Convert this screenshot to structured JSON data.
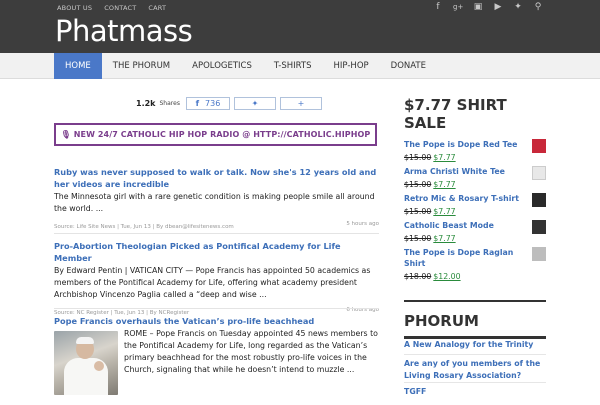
{
  "top_links": [
    "ABOUT US",
    "CONTACT",
    "CART"
  ],
  "social_icons": [
    "facebook-icon",
    "googleplus-icon",
    "instagram-icon",
    "youtube-icon",
    "twitter-icon",
    "search-icon"
  ],
  "site_title": "Phatmass",
  "nav": {
    "items": [
      "HOME",
      "THE PHORUM",
      "APOLOGETICS",
      "T-SHIRTS",
      "HIP-HOP",
      "DONATE"
    ],
    "active": "HOME"
  },
  "share": {
    "count": "1.2k",
    "label": "Shares",
    "facebook_count": "736"
  },
  "banner": "🎙 NEW 24/7 CATHOLIC HIP HOP RADIO @ HTTP://CATHOLIC.HIPHOP",
  "articles": [
    {
      "title": "Ruby was never supposed to walk or talk. Now she's 12 years old and her videos are incredible",
      "body": "The Minnesota girl with a rare genetic condition is making people smile all around the world. ...",
      "meta": "Source: Life Site News | Tue, Jun 13 | By dbean@lifesitenews.com",
      "ago": "5 hours ago"
    },
    {
      "title": "Pro-Abortion Theologian Picked as Pontifical Academy for Life Member",
      "body": "By Edward Pentin | VATICAN CITY — Pope Francis has appointed 50 academics as members of the Pontifical Academy for Life, offering what academy president Archbishop Vincenzo Paglia called a “deep and wise ...",
      "meta": "Source: NC Register | Tue, Jun 13 | By NCRegister",
      "ago": "6 hours ago"
    },
    {
      "title": "Pope Francis overhauls the Vatican’s pro-life beachhead",
      "body": "ROME – Pope Francis on Tuesday appointed 45 news members to the Pontifical Academy for Life, long regarded as the Vatican’s primary beachhead for the most robustly pro-life voices in the Church, signaling that while he doesn’t intend to muzzle ..."
    }
  ],
  "sidebar": {
    "shirt_heading": "$7.77 SHIRT SALE",
    "products": [
      {
        "name": "The Pope is Dope Red Tee",
        "old": "$15.00",
        "new": "$7.77",
        "color": "#c8283a"
      },
      {
        "name": "Arma Christi White Tee",
        "old": "$15.00",
        "new": "$7.77",
        "color": "#e8e8e8"
      },
      {
        "name": "Retro Mic & Rosary T-shirt",
        "old": "$15.00",
        "new": "$7.77",
        "color": "#2a2a2a"
      },
      {
        "name": "Catholic Beast Mode",
        "old": "$15.00",
        "new": "$7.77",
        "color": "#333333"
      },
      {
        "name": "The Pope is Dope Raglan Shirt",
        "old": "$18.00",
        "new": "$12.00",
        "color": "#bdbdbd"
      }
    ],
    "phorum_heading": "PHORUM",
    "phorum_links": [
      "A New Analogy for the Trinity",
      "Are any of you members of the Living Rosary Association?",
      "TGFF"
    ]
  }
}
